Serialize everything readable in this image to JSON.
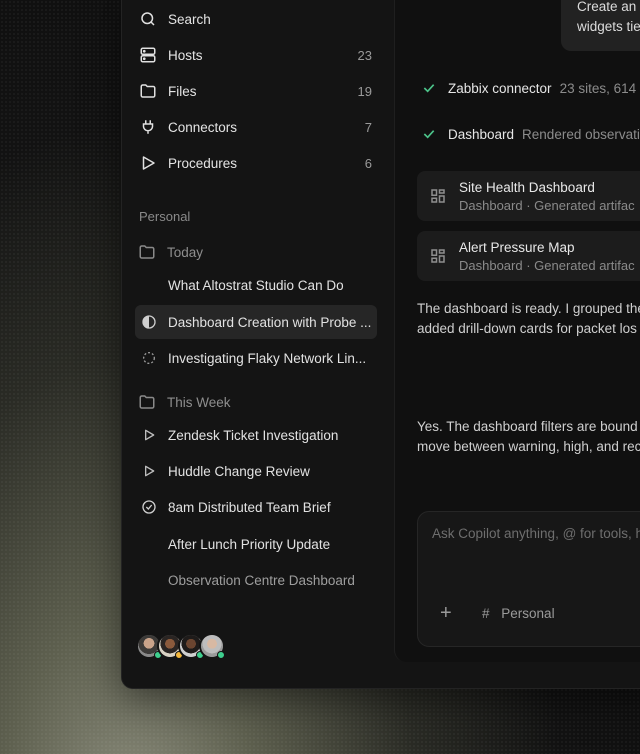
{
  "nav": [
    {
      "label": "Search",
      "icon": "search-icon",
      "count": ""
    },
    {
      "label": "Hosts",
      "icon": "server-icon",
      "count": "23"
    },
    {
      "label": "Files",
      "icon": "folder-icon",
      "count": "19"
    },
    {
      "label": "Connectors",
      "icon": "plug-icon",
      "count": "7"
    },
    {
      "label": "Procedures",
      "icon": "play-icon",
      "count": "6"
    }
  ],
  "personal_label": "Personal",
  "today": {
    "label": "Today",
    "items": [
      {
        "title": "What Altostrat Studio Can Do",
        "icon": ""
      },
      {
        "title": "Dashboard Creation with Probe ...",
        "icon": "half-circle-icon"
      },
      {
        "title": "Investigating Flaky Network Lin...",
        "icon": "dashed-circle-icon"
      }
    ]
  },
  "this_week": {
    "label": "This Week",
    "items": [
      {
        "title": "Zendesk Ticket Investigation",
        "icon": "play-outline-icon"
      },
      {
        "title": "Huddle Change Review",
        "icon": "play-outline-icon"
      },
      {
        "title": "8am Distributed Team Brief",
        "icon": "check-circle-icon"
      },
      {
        "title": "After Lunch Priority Update",
        "icon": ""
      },
      {
        "title": "Observation Centre Dashboard",
        "icon": ""
      }
    ]
  },
  "avatars": [
    {
      "status_color": "#3ecf8e"
    },
    {
      "status_color": "#f5b83d"
    },
    {
      "status_color": "#3ecf8e"
    },
    {
      "status_color": "#3ecf8e"
    }
  ],
  "chat": {
    "user_bubble": [
      "Create an c",
      "widgets tie"
    ],
    "steps": [
      {
        "name": "Zabbix connector",
        "desc": "23 sites, 614"
      },
      {
        "name": "Dashboard",
        "desc": "Rendered observatio"
      }
    ],
    "artifacts": [
      {
        "title": "Site Health Dashboard",
        "sub": "Dashboard · Generated artifac"
      },
      {
        "title": "Alert Pressure Map",
        "sub": "Dashboard · Generated artifac"
      }
    ],
    "reply1": [
      "The dashboard is ready. I grouped the",
      "added drill-down cards for packet los"
    ],
    "reply2": [
      "Yes. The dashboard filters are bound",
      "move between warning, high, and rec"
    ]
  },
  "composer": {
    "placeholder": "Ask Copilot anything, @ for tools, h",
    "context_label": "Personal",
    "plus_label": "+",
    "hash_label": "#"
  },
  "colors": {
    "accent_check": "#4cc38a"
  }
}
